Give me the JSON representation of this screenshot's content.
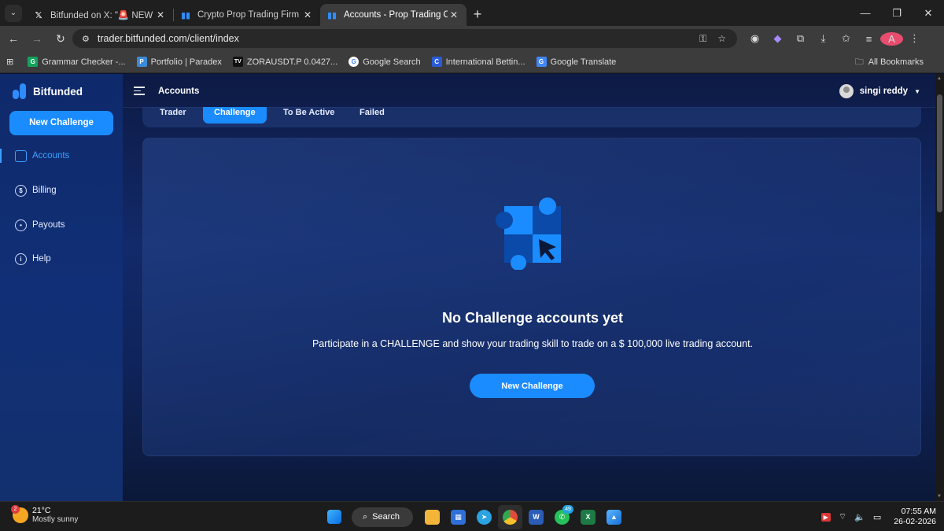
{
  "browser": {
    "tabs": [
      {
        "title": "Bitfunded on X: \"🚨 NEW GIVEAWAY",
        "fav": "X",
        "active": false
      },
      {
        "title": "Crypto Prop Trading Firm | Get Fu",
        "fav": "b",
        "active": false
      },
      {
        "title": "Accounts - Prop Trading Client",
        "fav": "b",
        "active": true
      }
    ],
    "url": "trader.bitfunded.com/client/index",
    "profile_initial": "A",
    "bookmarks": [
      {
        "label": "Grammar Checker -...",
        "color": "#15a35b",
        "glyph": "G"
      },
      {
        "label": "Portfolio | Paradex",
        "color": "#3b8bd6",
        "glyph": "P"
      },
      {
        "label": "ZORAUSDT.P 0.0427...",
        "color": "#111111",
        "glyph": "TV"
      },
      {
        "label": "Google Search",
        "color": "#4285f4",
        "glyph": "G"
      },
      {
        "label": "International Bettin...",
        "color": "#2b5cd6",
        "glyph": "C"
      },
      {
        "label": "Google Translate",
        "color": "#4285f4",
        "glyph": "G"
      }
    ],
    "all_bookmarks": "All Bookmarks"
  },
  "app": {
    "brand": "Bitfunded",
    "sidebar_cta": "New Challenge",
    "nav": [
      {
        "label": "Accounts",
        "glyph": "",
        "active": true
      },
      {
        "label": "Billing",
        "glyph": "$",
        "active": false
      },
      {
        "label": "Payouts",
        "glyph": "•",
        "active": false
      },
      {
        "label": "Help",
        "glyph": "i",
        "active": false
      }
    ],
    "page_title": "Accounts",
    "user_name": "singi reddy",
    "filter_tabs": [
      {
        "label": "Trader",
        "active": false
      },
      {
        "label": "Challenge",
        "active": true
      },
      {
        "label": "To Be Active",
        "active": false
      },
      {
        "label": "Failed",
        "active": false
      }
    ],
    "empty_title": "No Challenge accounts yet",
    "empty_subtitle": "Participate in a CHALLENGE and show your trading skill to trade on a $ 100,000 live trading account.",
    "empty_cta": "New Challenge",
    "accent": "#1a8cff"
  },
  "taskbar": {
    "weather_temp": "21°C",
    "weather_desc": "Mostly sunny",
    "weather_badge": "2",
    "search_label": "Search",
    "whatsapp_badge": "49",
    "time": "07:55 AM",
    "date": "26-02-2026"
  }
}
